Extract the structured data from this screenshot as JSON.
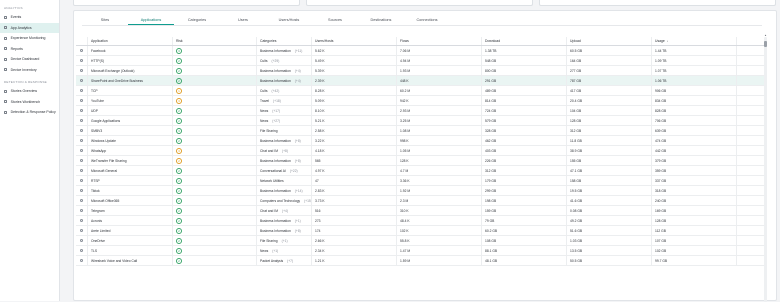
{
  "sidebar": {
    "sections": [
      {
        "title": "ANALYTICS",
        "items": [
          {
            "label": "Events",
            "active": false
          },
          {
            "label": "App Analytics",
            "active": true
          },
          {
            "label": "Experience Monitoring",
            "active": false
          },
          {
            "label": "Reports",
            "active": false
          },
          {
            "label": "Device Dashboard",
            "active": false
          },
          {
            "label": "Device Inventory",
            "active": false
          }
        ]
      },
      {
        "title": "DETECTION & RESPONSE",
        "items": [
          {
            "label": "Stories Overview",
            "active": false
          },
          {
            "label": "Stories Workbench",
            "active": false
          },
          {
            "label": "Detection & Response Policy",
            "active": false
          }
        ]
      }
    ]
  },
  "tabs": [
    "Sites",
    "Applications",
    "Categories",
    "Users",
    "Users/Hosts",
    "Sources",
    "Destinations",
    "Connections"
  ],
  "active_tab": 1,
  "table": {
    "headers": [
      "",
      "Application",
      "Risk",
      "Categories",
      "Users/Hosts",
      "Flows",
      "Download",
      "Upload",
      "Usage",
      ""
    ],
    "sort_arrow": "↓",
    "rows": [
      [
        "Facebook",
        "3",
        "Business Information",
        "(+11)",
        "5.62 K",
        "7.06 M",
        "1.38 TB",
        "60.5 GB",
        "1.44 TB"
      ],
      [
        "HTTP(S)",
        "2",
        "Cults",
        "(+29)",
        "5.49 K",
        "4.94 M",
        "548 GB",
        "164 GB",
        "1.09 TB"
      ],
      [
        "Microsoft Exchange (Outlook)",
        "2",
        "Business Information",
        "(+4)",
        "5.39 K",
        "1.93 M",
        "800 GB",
        "277 GB",
        "1.07 TB"
      ],
      [
        "SharePoint and OneDrive Business",
        "2",
        "Business Information",
        "(+4)",
        "2.39 K",
        "448 K",
        "291 GB",
        "787 GB",
        "1.06 TB"
      ],
      [
        "TCP",
        "1",
        "Cults",
        "(+42)",
        "8.28 K",
        "60.2 M",
        "489 GB",
        "417 GB",
        "906 GB"
      ],
      [
        "YouTube",
        "3",
        "Travel",
        "(+18)",
        "5.09 K",
        "942 K",
        "814 GB",
        "20.4 GB",
        "834 GB"
      ],
      [
        "UDP",
        "2",
        "News",
        "(+17)",
        "8.10 K",
        "2.93 M",
        "724 GB",
        "104 GB",
        "828 GB"
      ],
      [
        "Google Applications",
        "2",
        "News",
        "(+27)",
        "5.21 K",
        "3.25 M",
        "579 GB",
        "128 GB",
        "706 GB"
      ],
      [
        "SMBV3",
        "3",
        "File Sharing",
        "",
        "2.58 K",
        "1.08 M",
        "328 GB",
        "312 GB",
        "639 GB"
      ],
      [
        "Windows Update",
        "2",
        "Business Information",
        "(+8)",
        "3.22 K",
        "998 K",
        "462 GB",
        "11.8 GB",
        "474 GB"
      ],
      [
        "WhatsApp",
        "3",
        "Chat and IM",
        "(+8)",
        "4.18 K",
        "1.05 M",
        "403 GB",
        "38.9 GB",
        "442 GB"
      ],
      [
        "WeTransfer File Sharing",
        "2",
        "Business Information",
        "(+8)",
        "565",
        "128 K",
        "226 GB",
        "155 GB",
        "379 GB"
      ],
      [
        "Microsoft General",
        "2",
        "Conversational AI",
        "(+22)",
        "4.97 K",
        "4.7 M",
        "312 GB",
        "47.1 GB",
        "359 GB"
      ],
      [
        "RTSP",
        "2",
        "Network Utilities",
        "",
        "47",
        "3.36 K",
        "179 GB",
        "158 GB",
        "337 GB"
      ],
      [
        "Tiktok",
        "2",
        "Business Information",
        "(+14)",
        "2.83 K",
        "1.92 M",
        "299 GB",
        "19.5 GB",
        "318 GB"
      ],
      [
        "Microsoft Office365",
        "2",
        "Computers and Technology",
        "(+15)",
        "3.73 K",
        "2.3 M",
        "198 GB",
        "41.6 GB",
        "240 GB"
      ],
      [
        "Telegram",
        "2",
        "Chat and IM",
        "(+4)",
        "516",
        "310 K",
        "159 GB",
        "0.08 GB",
        "169 GB"
      ],
      [
        "Acronis",
        "2",
        "Business Information",
        "(+1)",
        "273",
        "48.4 K",
        "79 GB",
        "49.2 GB",
        "128 GB"
      ],
      [
        "Arete Limited",
        "2",
        "Business Information",
        "(+8)",
        "174",
        "102 K",
        "60.2 GB",
        "51.6 GB",
        "112 GB"
      ],
      [
        "OneDrive",
        "2",
        "File Sharing",
        "(+1)",
        "2.66 K",
        "55.8 K",
        "108 GB",
        "1.03 GB",
        "107 GB"
      ],
      [
        "TLS",
        "2",
        "News",
        "(+1)",
        "2.34 K",
        "1.47 M",
        "88.1 GB",
        "13.5 GB",
        "102 GB"
      ],
      [
        "Wireshark Voice and Video Call",
        "2",
        "Packet Analysis",
        "(+7)",
        "1.21 K",
        "1.59 M",
        "48.1 GB",
        "50.5 GB",
        "99.7 GB"
      ]
    ],
    "selected_row": 3,
    "medium_risk_rows": [
      4,
      5,
      10,
      11
    ]
  },
  "colors": {
    "accent": "#0f9d8f",
    "selected_row": "#eaf5f3",
    "sidebar_active": "#dff1ef"
  }
}
